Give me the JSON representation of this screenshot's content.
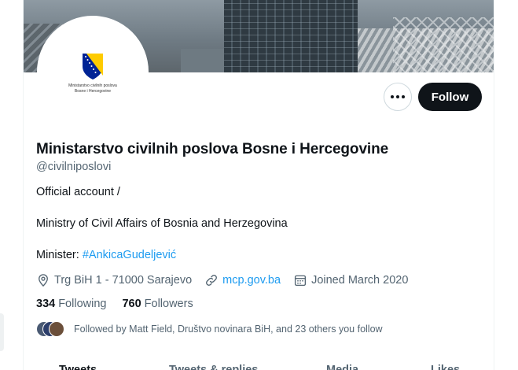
{
  "profile": {
    "name": "Ministarstvo civilnih poslova Bosne i Hercegovine",
    "handle": "@civilniposlovi",
    "avatar_caption": "Ministarstvo civilnih poslova Bosne i Hercegovine",
    "bio": {
      "line1": "Official account /",
      "line2": "Ministry of Civil Affairs of Bosnia and Herzegovina",
      "line3_prefix": "Minister: ",
      "line3_hashtag": "#AnkicaGudeljević"
    },
    "location": "Trg BiH 1 - 71000 Sarajevo",
    "website": "mcp.gov.ba",
    "joined": "Joined March 2020",
    "following_count": "334",
    "following_label": "Following",
    "followers_count": "760",
    "followers_label": "Followers",
    "followed_by": "Followed by Matt Field, Društvo novinara BiH, and 23 others you follow"
  },
  "actions": {
    "follow_label": "Follow",
    "more_icon": "more-horizontal-icon"
  },
  "icons": {
    "location": "location-pin-icon",
    "link": "link-icon",
    "calendar": "calendar-icon"
  },
  "tabs": [
    {
      "label": "Tweets"
    },
    {
      "label": "Tweets & replies"
    },
    {
      "label": "Media"
    },
    {
      "label": "Likes"
    }
  ],
  "colors": {
    "accent": "#1d9bf0",
    "text": "#0f1419",
    "secondary_text": "#536471",
    "follow_button_bg": "#0f1419"
  }
}
